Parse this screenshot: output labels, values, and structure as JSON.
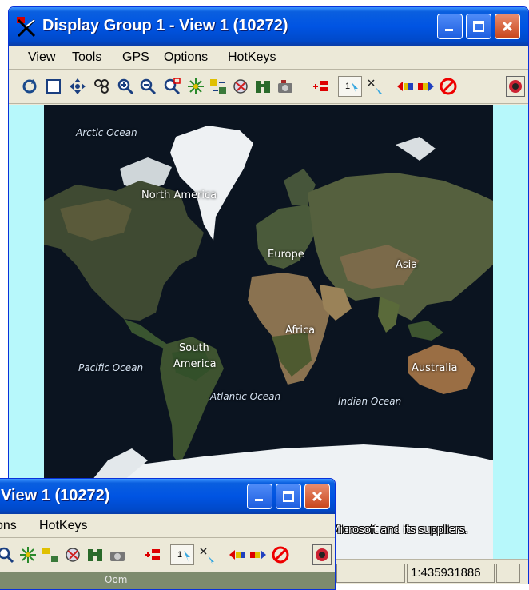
{
  "window": {
    "title": "Display Group 1 - View 1 (10272)",
    "menu": [
      "View",
      "Tools",
      "GPS",
      "Options",
      "HotKeys"
    ],
    "controls": {
      "minimize": "minimize-icon",
      "maximize": "maximize-icon",
      "close": "close-icon"
    }
  },
  "toolbar": {
    "icons": [
      "redraw-icon",
      "full-extent-icon",
      "pan-icon",
      "zoom-extent-icon",
      "zoom-in-icon",
      "zoom-out-icon",
      "zoom-box-icon",
      "scatter-icon",
      "arrows-icon",
      "globe-icon",
      "binoculars-icon",
      "camera-icon",
      "add-layer-icon",
      "select-1-icon",
      "measure-icon",
      "prev-view-icon",
      "next-view-icon",
      "stop-icon",
      "gps-icon"
    ],
    "select_label": "1"
  },
  "map": {
    "labels": {
      "arctic_ocean": "Arctic Ocean",
      "north_america": "North America",
      "europe": "Europe",
      "asia": "Asia",
      "africa": "Africa",
      "south_america_1": "South",
      "south_america_2": "America",
      "australia": "Australia",
      "pacific_ocean": "Pacific Ocean",
      "atlantic_ocean": "Atlantic Ocean",
      "indian_ocean": "Indian Ocean"
    },
    "copyright": "Microsoft and its suppliers."
  },
  "status": {
    "scale": "1:435931886"
  },
  "window2": {
    "title": "View 1 (10272)",
    "menu_partial": "ons",
    "menu_hotkeys": "HotKeys",
    "select_label": "1",
    "map_text": "Oom"
  },
  "colors": {
    "title_blue": "#0054e3",
    "chrome": "#ece9d8",
    "map_bg": "#b7f8fb",
    "ocean": "#0b1420"
  }
}
